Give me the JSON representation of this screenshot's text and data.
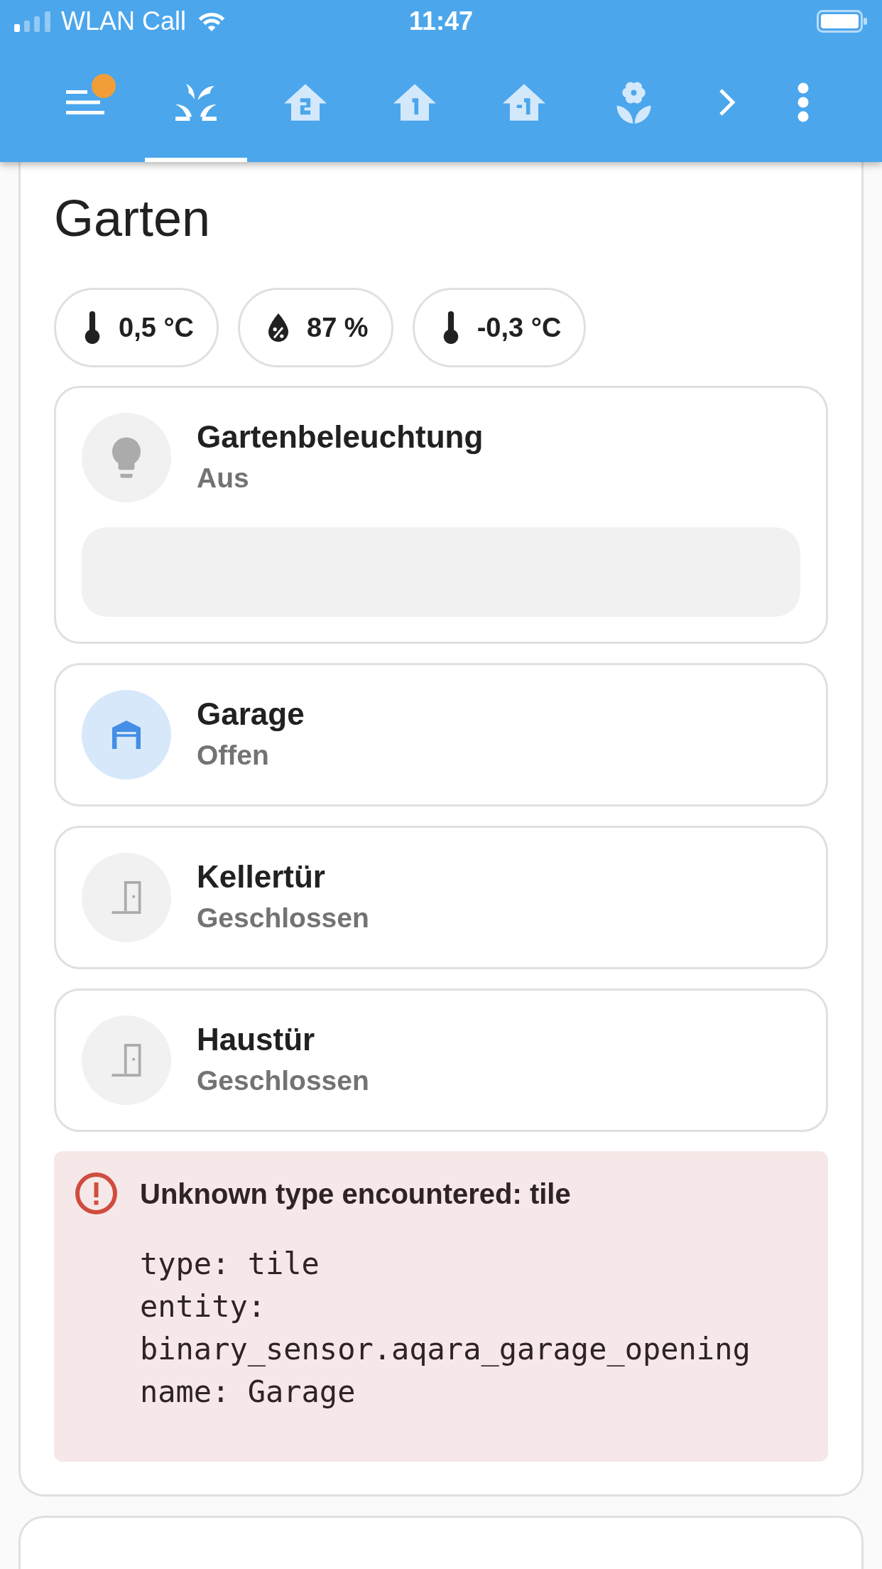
{
  "status_bar": {
    "carrier": "WLAN Call",
    "time": "11:47"
  },
  "toolbar": {
    "notification": true,
    "tabs": [
      {
        "kind": "garden",
        "selected": true
      },
      {
        "kind": "floor_2",
        "selected": false
      },
      {
        "kind": "floor_1",
        "selected": false
      },
      {
        "kind": "floor_minus_1",
        "selected": false
      },
      {
        "kind": "flower",
        "selected": false
      }
    ]
  },
  "section": {
    "title": "Garten",
    "chips": [
      {
        "kind": "temperature",
        "value": "0,5 °C"
      },
      {
        "kind": "humidity",
        "value": "87 %"
      },
      {
        "kind": "temperature",
        "value": "-0,3 °C"
      }
    ],
    "tiles": [
      {
        "kind": "light",
        "name": "Gartenbeleuchtung",
        "state": "Aus",
        "active": false,
        "slider": {
          "level": 0
        }
      },
      {
        "kind": "garage",
        "name": "Garage",
        "state": "Offen",
        "active": true
      },
      {
        "kind": "door",
        "name": "Kellertür",
        "state": "Geschlossen",
        "active": false
      },
      {
        "kind": "door",
        "name": "Haustür",
        "state": "Geschlossen",
        "active": false
      }
    ],
    "error": {
      "title": "Unknown type encountered: tile",
      "code_lines": [
        "type: tile",
        "entity: binary_sensor.aqara_garage_opening",
        "name: Garage"
      ]
    }
  }
}
